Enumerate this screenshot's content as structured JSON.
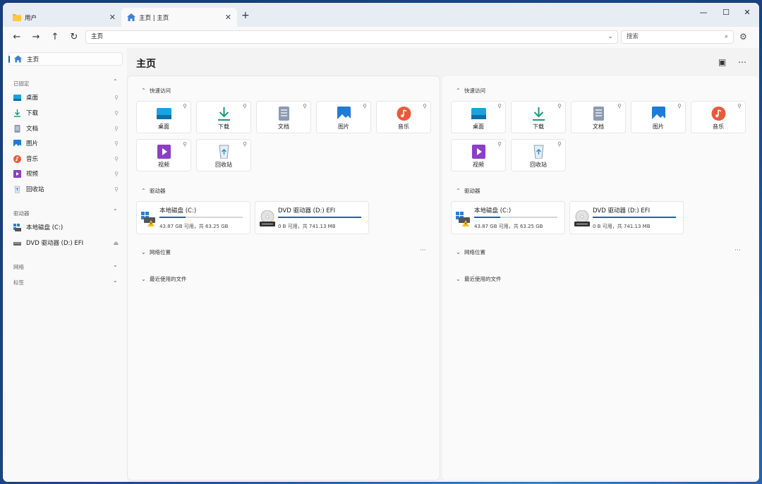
{
  "tabs": [
    {
      "label": "用户",
      "icon": "folder-icon"
    },
    {
      "label": "主页 | 主页",
      "icon": "home-icon"
    }
  ],
  "toolbar": {
    "address": "主页",
    "search_placeholder": "搜索"
  },
  "sidebar": {
    "home_label": "主页",
    "pinned_section": "已固定",
    "pinned": [
      {
        "label": "桌面",
        "icon": "desktop-icon"
      },
      {
        "label": "下载",
        "icon": "download-icon"
      },
      {
        "label": "文档",
        "icon": "document-icon"
      },
      {
        "label": "图片",
        "icon": "pictures-icon"
      },
      {
        "label": "音乐",
        "icon": "music-icon"
      },
      {
        "label": "视频",
        "icon": "video-icon"
      },
      {
        "label": "回收站",
        "icon": "recycle-bin-icon"
      }
    ],
    "drives_section": "驱动器",
    "drives": [
      {
        "label": "本地磁盘 (C:)",
        "icon": "local-disk-icon"
      },
      {
        "label": "DVD 驱动器 (D:) EFI",
        "icon": "dvd-drive-icon"
      }
    ],
    "network_section": "网络",
    "tags_section": "标签"
  },
  "main": {
    "title": "主页",
    "quick_access_title": "快速访问",
    "quick_access": [
      {
        "label": "桌面",
        "icon": "desktop-icon"
      },
      {
        "label": "下载",
        "icon": "download-icon"
      },
      {
        "label": "文档",
        "icon": "document-icon"
      },
      {
        "label": "图片",
        "icon": "pictures-icon"
      },
      {
        "label": "音乐",
        "icon": "music-icon"
      },
      {
        "label": "视频",
        "icon": "video-icon"
      },
      {
        "label": "回收站",
        "icon": "recycle-bin-icon"
      }
    ],
    "drives_title": "驱动器",
    "drives": [
      {
        "name": "本地磁盘 (C:)",
        "info": "43.87 GB 可用，共 63.25 GB",
        "used_fraction": 0.31,
        "icon": "local-disk-warning-icon"
      },
      {
        "name": "DVD 驱动器 (D:) EFI",
        "info": "0 B 可用，共 741.13 MB",
        "used_fraction": 1.0,
        "icon": "dvd-rom-icon"
      }
    ],
    "network_title": "网络位置",
    "recent_title": "最近使用的文件"
  },
  "colors": {
    "accent": "#0067c0"
  }
}
